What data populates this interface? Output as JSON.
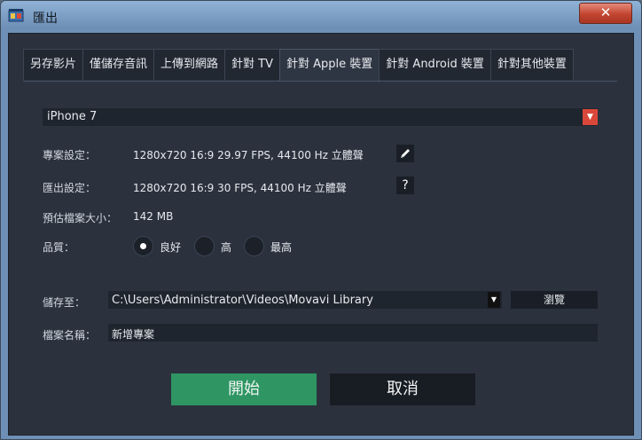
{
  "window": {
    "title": "匯出",
    "close_label": "✕"
  },
  "tabs": [
    {
      "label": "另存影片"
    },
    {
      "label": "僅儲存音訊"
    },
    {
      "label": "上傳到網路"
    },
    {
      "label": "針對 TV"
    },
    {
      "label": "針對 Apple 裝置",
      "active": true
    },
    {
      "label": "針對 Android 裝置"
    },
    {
      "label": "針對其他裝置"
    }
  ],
  "device": {
    "selected": "iPhone 7",
    "arrow": "▼"
  },
  "project_settings": {
    "label": "專案設定：",
    "value": "1280x720 16:9 29.97 FPS, 44100 Hz 立體聲"
  },
  "export_settings": {
    "label": "匯出設定：",
    "value": "1280x720 16:9 30 FPS, 44100 Hz 立體聲",
    "help": "?"
  },
  "estimated_size": {
    "label": "預估檔案大小：",
    "value": "142 MB"
  },
  "quality": {
    "label": "品質：",
    "options": [
      {
        "label": "良好",
        "selected": true
      },
      {
        "label": "高",
        "selected": false
      },
      {
        "label": "最高",
        "selected": false
      }
    ]
  },
  "save_to": {
    "label": "儲存至：",
    "path": "C:\\Users\\Administrator\\Videos\\Movavi Library",
    "arrow": "▼",
    "browse_label": "瀏覽"
  },
  "file_name": {
    "label": "檔案名稱：",
    "value": "新增專案"
  },
  "actions": {
    "start": "開始",
    "cancel": "取消"
  },
  "colors": {
    "accent_green": "#2e9563",
    "dropdown_red": "#d9473a",
    "background": "#2b323e"
  }
}
